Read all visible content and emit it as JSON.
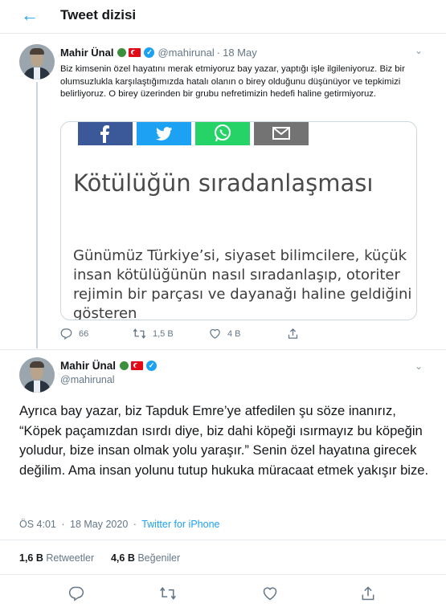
{
  "header": {
    "title": "Tweet dizisi",
    "back_icon": "arrow-left-icon"
  },
  "tweet1": {
    "author_name": "Mahir Ünal",
    "handle": "@mahirunal",
    "separator": "·",
    "date": "18 May",
    "text": "Biz kimsenin özel hayatını merak etmiyoruz bay yazar, yaptığı işle ilgileniyoruz. Biz bir olumsuzlukla karşılaştığımızda hatalı olanın o birey olduğunu düşünüyor ve tepkimizi belirliyoruz. O birey üzerinden bir grubu nefretimizin  hedefi haline getirmiyoruz.",
    "card": {
      "share_icons": [
        "facebook-icon",
        "twitter-icon",
        "whatsapp-icon",
        "mail-icon"
      ],
      "title": "Kötülüğün sıradanlaşması",
      "body": "Günümüz Türkiye’si, siyaset bilimcilere, küçük insan kötülüğünün nasıl sıradanlaşıp, otoriter rejimin bir parçası ve dayanağı haline geldiğini gösteren"
    },
    "replies": "66",
    "retweets": "1,5 B",
    "likes": "4 B"
  },
  "tweet2": {
    "author_name": "Mahir Ünal",
    "handle": "@mahirunal",
    "text": "Ayrıca bay yazar, biz Tapduk Emre’ye atfedilen şu söze inanırız, “Köpek paçamızdan ısırdı diye, biz dahi köpeği ısırmayız bu köpeğin yoludur, bize insan olmak yolu yaraşır.” Senin özel hayatına girecek değilim. Ama insan yolunu tutup hukuka müracaat etmek yakışır bize.",
    "time": "ÖS 4:01",
    "date": "18 May 2020",
    "separator": "·",
    "source": "Twitter for iPhone",
    "retweet_count": "1,6 B",
    "retweet_label": "Retweetler",
    "like_count": "4,6 B",
    "like_label": "Beğeniler"
  },
  "colors": {
    "accent": "#1da1f2",
    "text": "#14171a",
    "muted": "#657786",
    "border": "#e6ecf0",
    "flag_red": "#e30a17",
    "badge_green": "#3c8f3c"
  }
}
